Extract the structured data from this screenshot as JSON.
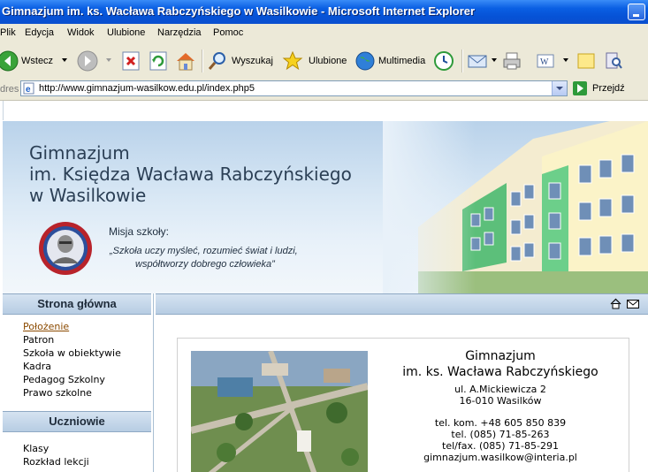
{
  "window": {
    "title": "Gimnazjum im. ks. Wacława Rabczyńskiego w Wasilkowie - Microsoft Internet Explorer"
  },
  "menubar": [
    "Plik",
    "Edycja",
    "Widok",
    "Ulubione",
    "Narzędzia",
    "Pomoc"
  ],
  "toolbar": {
    "back_label": "Wstecz",
    "search_label": "Wyszukaj",
    "favorites_label": "Ulubione",
    "media_label": "Multimedia"
  },
  "address": {
    "label": "dres",
    "url": "http://www.gimnazjum-wasilkow.edu.pl/index.php5",
    "go_label": "Przejdź"
  },
  "banner": {
    "title_line1": "Gimnazjum",
    "title_line2": "im. Księdza Wacława Rabczyńskiego",
    "title_line3": "w Wasilkowie",
    "mission_label": "Misja szkoły:",
    "mission_line1": "„Szkoła uczy myśleć, rozumieć świat i ludzi,",
    "mission_line2": "współtworzy dobrego człowieka”"
  },
  "nav": {
    "section1_title": "Strona główna",
    "section1_links": [
      "Położenie",
      "Patron",
      "Szkoła w obiektywie",
      "Kadra",
      "Pedagog Szkolny",
      "Prawo szkolne"
    ],
    "section2_title": "Uczniowie",
    "section2_links": [
      "Klasy",
      "Rozkład lekcji"
    ]
  },
  "info": {
    "name_line1": "Gimnazjum",
    "name_line2": "im. ks. Wacława Rabczyńskiego",
    "street": "ul. A.Mickiewicza 2",
    "city": "16-010 Wasilków",
    "mobile": "tel. kom. +48 605 850 839",
    "phone": "tel. (085) 71-85-263",
    "fax": "tel/fax. (085) 71-85-291",
    "email": "gimnazjum.wasilkow@interia.pl"
  },
  "colors": {
    "titlebar": "#0a5fe3",
    "chrome": "#ece9d8",
    "nav_header": "#b7cde3",
    "active_link": "#8b4a00"
  }
}
